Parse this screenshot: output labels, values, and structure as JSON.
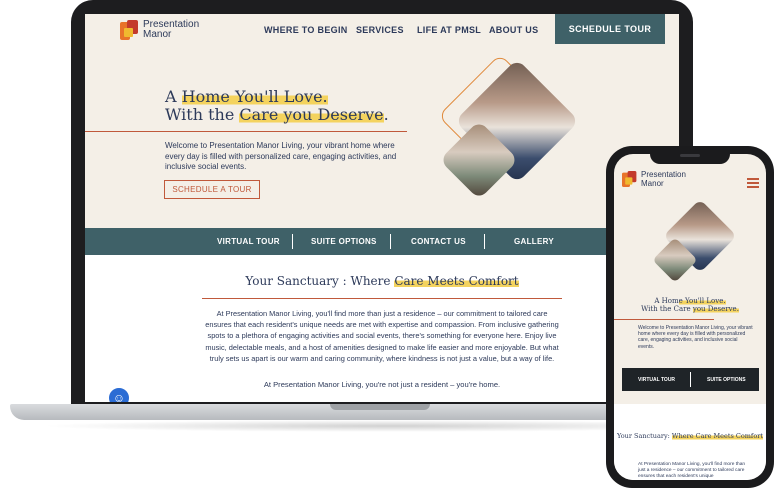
{
  "brand": {
    "name_line1": "Presentation",
    "name_line2": "Manor",
    "colors": {
      "teal": "#3f6168",
      "rust": "#c0593b",
      "highlight": "#f4d35e",
      "navy": "#2d3a5a",
      "cream": "#f4efe7"
    }
  },
  "desktop": {
    "nav": {
      "items": [
        "WHERE TO BEGIN",
        "SERVICES",
        "LIFE AT PMSL",
        "ABOUT US"
      ],
      "cta": "SCHEDULE TOUR"
    },
    "hero": {
      "title_pre1": "A ",
      "title_hl1": "Home You'll Love.",
      "title_pre2": "With the ",
      "title_hl2": "Care you Deserve",
      "title_post2": ".",
      "body": "Welcome to Presentation Manor Living, your vibrant home where every day is filled with personalized care, engaging activities, and inclusive social events.",
      "button": "SCHEDULE A TOUR"
    },
    "subnav": [
      "VIRTUAL TOUR",
      "SUITE OPTIONS",
      "CONTACT US",
      "GALLERY"
    ],
    "section": {
      "title_pre": "Your Sanctuary : Where ",
      "title_hl": "Care Meets Comfort",
      "body": "At Presentation Manor Living, you'll find more than just a residence – our commitment to tailored care ensures that each resident's unique needs are met with expertise and compassion. From inclusive gathering spots to a plethora of engaging activities and social events, there's something for everyone here. Enjoy live music, delectable meals, and a host of amenities designed to make life easier and more enjoyable. But what truly sets us apart is our warm and caring community, where kindness is not just a value, but a way of life.",
      "tagline": "At Presentation Manor Living, you're not just a resident – you're home."
    },
    "accessibility_icon": "accessibility-icon"
  },
  "mobile": {
    "hero": {
      "title_pre1": "A Hom",
      "title_hl1": "e You'll Love.",
      "title_pre2": "With the Care ",
      "title_hl2": "you Deserve.",
      "body": "Welcome to Presentation Manor Living, your vibrant home where every day is filled with personalized care, engaging activities, and inclusive social events."
    },
    "subnav": [
      "VIRTUAL TOUR",
      "SUITE OPTIONS"
    ],
    "section": {
      "title_pre": "Your Sanctuary: ",
      "title_hl": "Where Care Meets Comfort",
      "body": "At Presentation Manor Living, you'll find more than just a residence – our commitment to tailored care ensures that each resident's unique"
    },
    "menu_icon": "hamburger-menu-icon"
  }
}
